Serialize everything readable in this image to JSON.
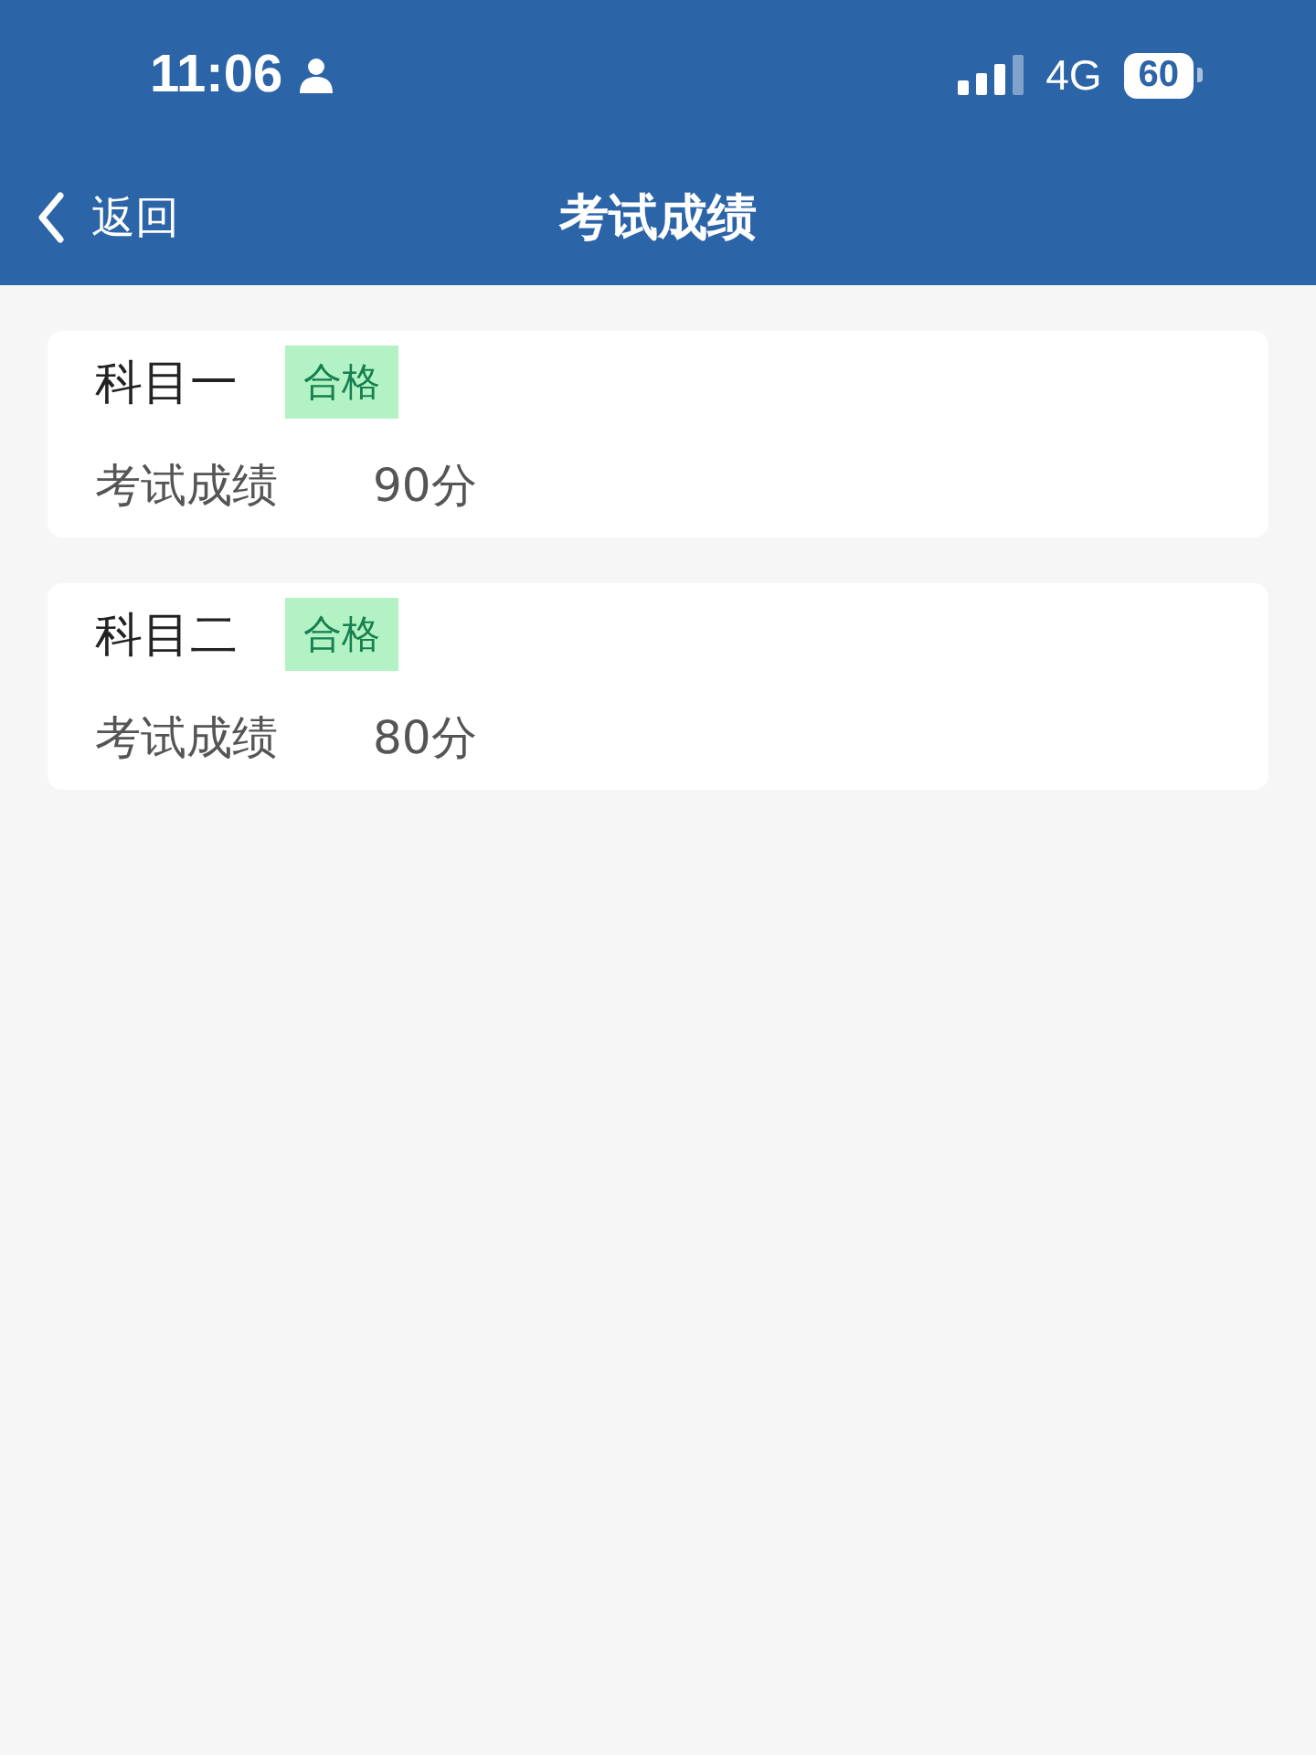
{
  "status_bar": {
    "time": "11:06",
    "network": "4G",
    "battery": "60"
  },
  "nav_bar": {
    "back": "返回",
    "title": "考试成绩"
  },
  "results": [
    {
      "subject": "科目一",
      "badge": "合格",
      "label": "考试成绩",
      "score": "90分"
    },
    {
      "subject": "科目二",
      "badge": "合格",
      "label": "考试成绩",
      "score": "80分"
    }
  ]
}
